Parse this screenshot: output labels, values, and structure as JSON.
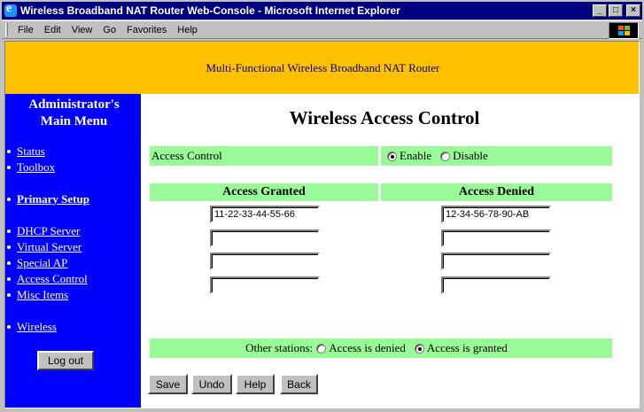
{
  "window": {
    "title": "Wireless Broadband NAT Router Web-Console - Microsoft Internet Explorer",
    "controls": {
      "minimize": "_",
      "maximize": "□",
      "close": "×"
    }
  },
  "menubar": {
    "items": [
      {
        "label": "File"
      },
      {
        "label": "Edit"
      },
      {
        "label": "View"
      },
      {
        "label": "Go"
      },
      {
        "label": "Favorites"
      },
      {
        "label": "Help"
      }
    ]
  },
  "banner": {
    "text": "Multi-Functional Wireless Broadband NAT Router"
  },
  "sidebar": {
    "heading_line1": "Administrator's",
    "heading_line2": "Main Menu",
    "links": [
      {
        "label": "Status",
        "bold": false
      },
      {
        "label": "Toolbox",
        "bold": false
      },
      {
        "label": "Primary Setup",
        "bold": true
      },
      {
        "label": "DHCP Server",
        "bold": false
      },
      {
        "label": "Virtual Server",
        "bold": false
      },
      {
        "label": "Special AP",
        "bold": false
      },
      {
        "label": "Access Control",
        "bold": false
      },
      {
        "label": "Misc Items",
        "bold": false
      },
      {
        "label": "Wireless",
        "bold": false
      }
    ],
    "logout_label": "Log out"
  },
  "content": {
    "title": "Wireless Access Control",
    "access_control": {
      "label": "Access Control",
      "options": [
        "Enable",
        "Disable"
      ],
      "selected": "Enable"
    },
    "granted": {
      "header": "Access Granted",
      "values": [
        "11-22-33-44-55-66",
        "",
        "",
        ""
      ]
    },
    "denied": {
      "header": "Access Denied",
      "values": [
        "12-34-56-78-90-AB",
        "",
        "",
        ""
      ]
    },
    "other_stations": {
      "label": "Other stations:",
      "options": [
        "Access is denied",
        "Access is granted"
      ],
      "selected": "Access is granted"
    },
    "buttons": {
      "save": "Save",
      "undo": "Undo",
      "help": "Help",
      "back": "Back"
    }
  },
  "colors": {
    "banner_bg": "#ffc000",
    "banner_text": "#000080",
    "sidebar_bg": "#0000ff",
    "row_bg": "#98fb98",
    "titlebar_bg": "#000080"
  }
}
